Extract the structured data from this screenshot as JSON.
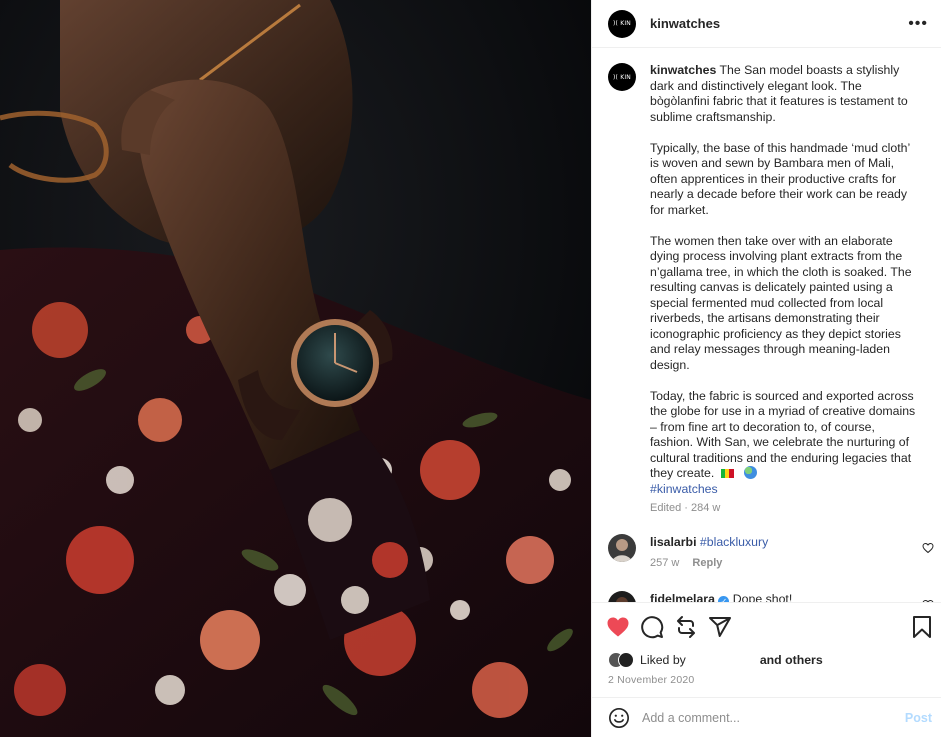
{
  "post": {
    "username": "kinwatches",
    "avatar_text": ")( KIN",
    "more_icon": "more-horizontal-icon"
  },
  "caption": {
    "username": "kinwatches",
    "paragraphs": [
      "The San model boasts a stylishly dark and distinctively elegant look. The bògòlanfini fabric that it features is testament to sublime craftsmanship.",
      "Typically, the base of this handmade ‘mud cloth’ is woven and sewn by Bambara men of Mali, often apprentices in their productive crafts for nearly a decade before their work can be ready for market.",
      "The women then take over with an elaborate dying process involving plant extracts from the n’gallama tree, in which the cloth is soaked. The resulting canvas is delicately painted using a special fermented mud collected from local riverbeds, the artisans demonstrating their iconographic proficiency as they depict stories and relay messages through meaning-laden design.",
      "Today, the fabric is sourced and exported across the globe for use in a myriad of creative domains – from fine art to decoration to, of course, fashion. With San, we celebrate the nurturing of cultural traditions and the enduring legacies that they create."
    ],
    "hashtag": "#kinwatches",
    "edited": "Edited · 284 w"
  },
  "comments": [
    {
      "username": "lisalarbi",
      "text": "#blackluxury",
      "age": "257 w",
      "reply_label": "Reply"
    },
    {
      "username": "fidelmelara",
      "text": "Dope shot!"
    }
  ],
  "actions": {
    "liked_by_label": "Liked by",
    "and_others": "and others",
    "date": "2 November 2020",
    "heart_color": "#ed4956"
  },
  "add_comment": {
    "placeholder": "Add a comment...",
    "post_label": "Post"
  },
  "colors": {
    "link": "#3a5ca8",
    "muted": "#8e8e8e",
    "post_button": "#b3dbff"
  }
}
